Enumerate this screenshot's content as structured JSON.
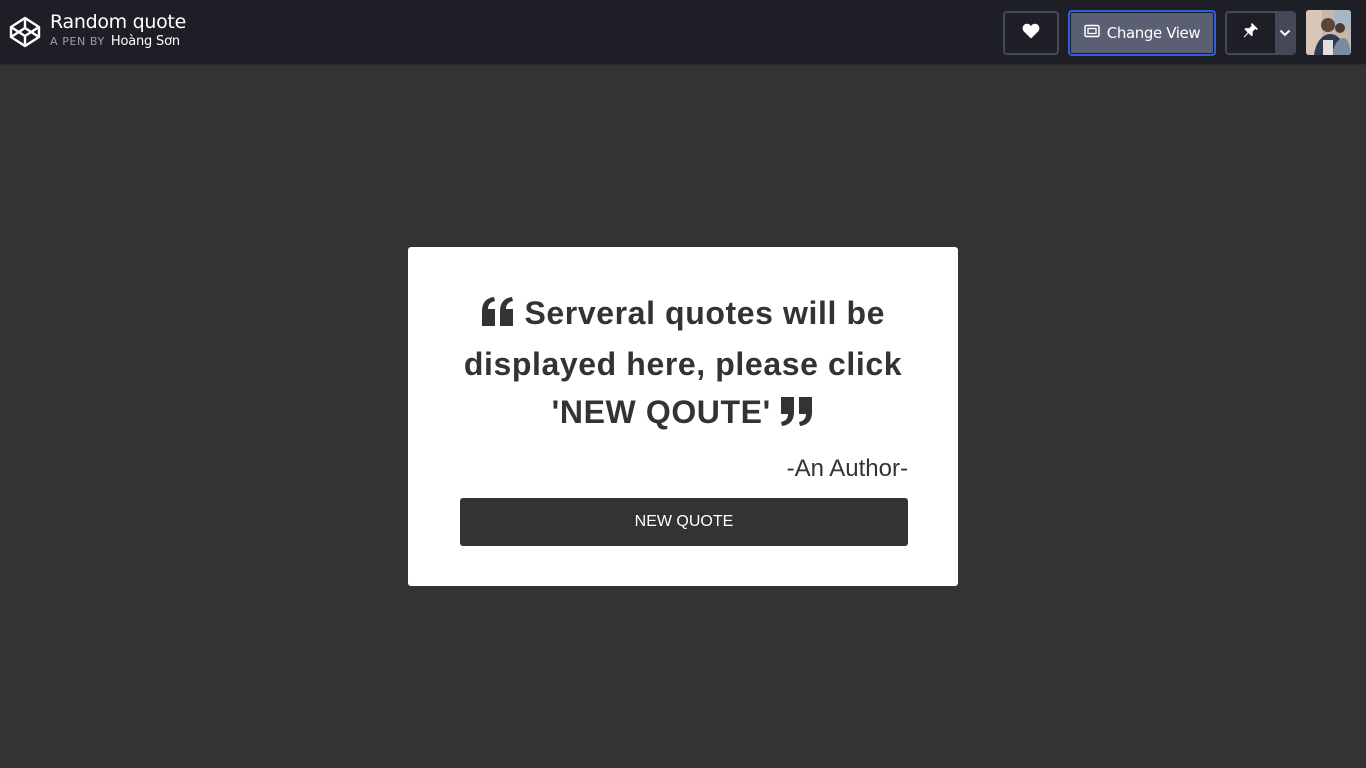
{
  "header": {
    "pen_title": "Random quote",
    "pen_by": "A PEN BY",
    "author": "Hoàng Sơn",
    "change_view_label": "Change View",
    "icons": {
      "logo": "codepen-logo-icon",
      "heart": "heart-icon",
      "view": "view-icon",
      "pin": "pin-icon",
      "menu": "chevron-down-icon"
    }
  },
  "quote_box": {
    "quote_text": "Serveral quotes will be displayed here, please click 'NEW QOUTE'",
    "author": "-An Author-",
    "button_label": "NEW QUOTE"
  },
  "colors": {
    "page_background": "#333333",
    "header_background": "#1e1f26",
    "card_background": "#ffffff",
    "accent_border": "#2f5fd8"
  }
}
